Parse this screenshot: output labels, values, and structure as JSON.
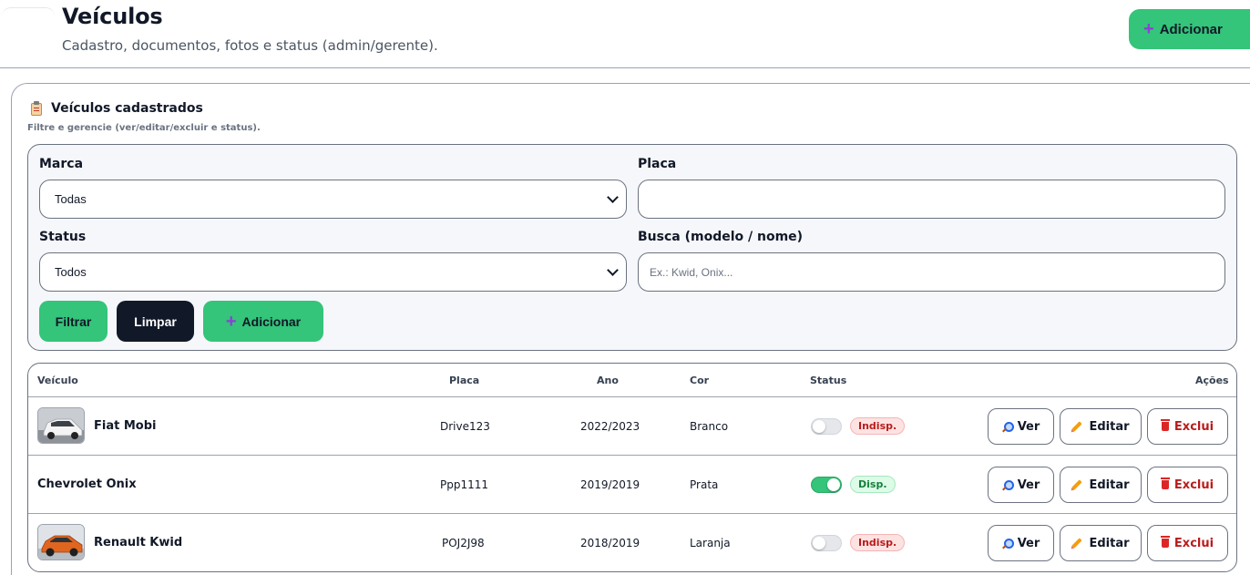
{
  "header": {
    "title": "Veículos",
    "subtitle": "Cadastro, documentos, fotos e status (admin/gerente).",
    "add_label": "Adicionar"
  },
  "card": {
    "title": "Veículos cadastrados",
    "subtitle": "Filtre e gerencie (ver/editar/excluir e status)."
  },
  "filters": {
    "brand_label": "Marca",
    "brand_value": "Todas",
    "plate_label": "Placa",
    "plate_value": "",
    "status_label": "Status",
    "status_value": "Todos",
    "search_label": "Busca (modelo / nome)",
    "search_placeholder": "Ex.: Kwid, Onix...",
    "filter_button": "Filtrar",
    "clear_button": "Limpar",
    "add_button": "Adicionar"
  },
  "table": {
    "columns": [
      "Veículo",
      "Placa",
      "Ano",
      "Cor",
      "Status",
      "Ações"
    ],
    "actions": {
      "view": "Ver",
      "edit": "Editar",
      "delete": "Exclui"
    },
    "rows": [
      {
        "name": "Fiat Mobi",
        "plate": "Drive123",
        "year": "2022/2023",
        "color": "Branco",
        "available": false,
        "status": "Indisp.",
        "has_photo": true
      },
      {
        "name": "Chevrolet Onix",
        "plate": "Ppp1111",
        "year": "2019/2019",
        "color": "Prata",
        "available": true,
        "status": "Disp.",
        "has_photo": false
      },
      {
        "name": "Renault Kwid",
        "plate": "POJ2J98",
        "year": "2018/2019",
        "color": "Laranja",
        "available": false,
        "status": "Indisp.",
        "has_photo": true
      }
    ]
  },
  "colors": {
    "accent_green": "#34c47a",
    "dark_button": "#111827",
    "plus_purple": "#8b3fd6",
    "danger_red": "#b91c1c"
  }
}
